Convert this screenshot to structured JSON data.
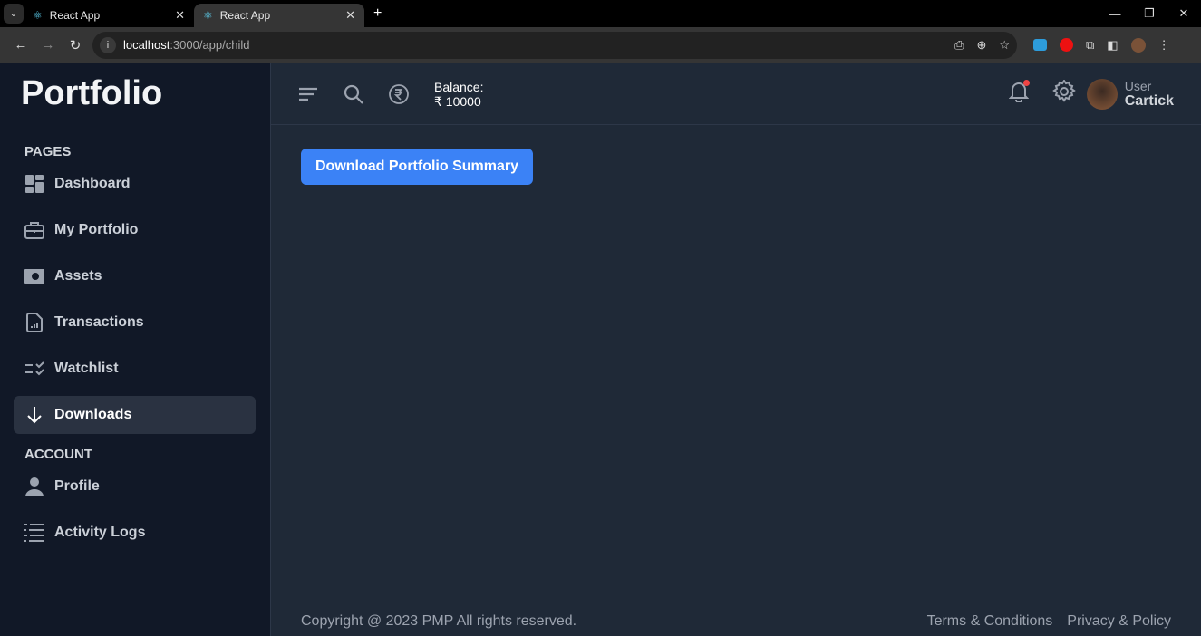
{
  "browser": {
    "tabs": [
      {
        "title": "React App"
      },
      {
        "title": "React App",
        "active": true
      }
    ],
    "url_host": "localhost",
    "url_path": ":3000/app/child"
  },
  "sidebar": {
    "logo": "Portfolio",
    "sections": [
      {
        "title": "PAGES",
        "items": [
          {
            "label": "Dashboard",
            "icon": "dashboard-icon"
          },
          {
            "label": "My Portfolio",
            "icon": "briefcase-icon"
          },
          {
            "label": "Assets",
            "icon": "cash-icon"
          },
          {
            "label": "Transactions",
            "icon": "report-file-icon"
          },
          {
            "label": "Watchlist",
            "icon": "checklist-icon"
          },
          {
            "label": "Downloads",
            "icon": "arrow-down-icon",
            "active": true
          }
        ]
      },
      {
        "title": "ACCOUNT",
        "items": [
          {
            "label": "Profile",
            "icon": "user-icon"
          },
          {
            "label": "Activity Logs",
            "icon": "list-icon"
          }
        ]
      }
    ]
  },
  "header": {
    "balance_label": "Balance:",
    "balance_value": "₹ 10000",
    "user_role": "User",
    "user_name": "Cartick",
    "notification_dot_color": "#ef4444"
  },
  "main": {
    "download_button": "Download Portfolio Summary",
    "accent": "#3b82f6"
  },
  "footer": {
    "copyright": "Copyright @ 2023 PMP All rights reserved.",
    "links": [
      "Terms & Conditions",
      "Privacy & Policy"
    ]
  }
}
